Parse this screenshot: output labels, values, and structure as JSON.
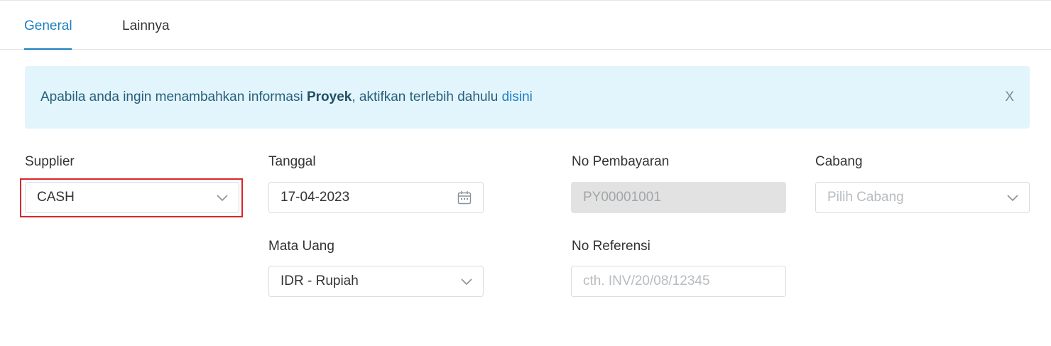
{
  "tabs": {
    "general": "General",
    "lainnya": "Lainnya"
  },
  "alert": {
    "text_before": "Apabila anda ingin menambahkan informasi ",
    "bold": "Proyek",
    "text_after": ", aktifkan terlebih dahulu ",
    "link": "disini",
    "close": "X"
  },
  "form": {
    "supplier": {
      "label": "Supplier",
      "value": "CASH"
    },
    "tanggal": {
      "label": "Tanggal",
      "value": "17-04-2023"
    },
    "no_pembayaran": {
      "label": "No Pembayaran",
      "value": "PY00001001"
    },
    "cabang": {
      "label": "Cabang",
      "placeholder": "Pilih Cabang"
    },
    "mata_uang": {
      "label": "Mata Uang",
      "value": "IDR - Rupiah"
    },
    "no_referensi": {
      "label": "No Referensi",
      "placeholder": "cth. INV/20/08/12345"
    }
  },
  "icons": {
    "dropdown": "chevron-down-icon",
    "calendar": "calendar-icon"
  },
  "colors": {
    "accent": "#1a7fc1",
    "alert_bg": "#e2f4fc",
    "highlight": "#d8262b",
    "disabled_bg": "#e2e2e2"
  }
}
